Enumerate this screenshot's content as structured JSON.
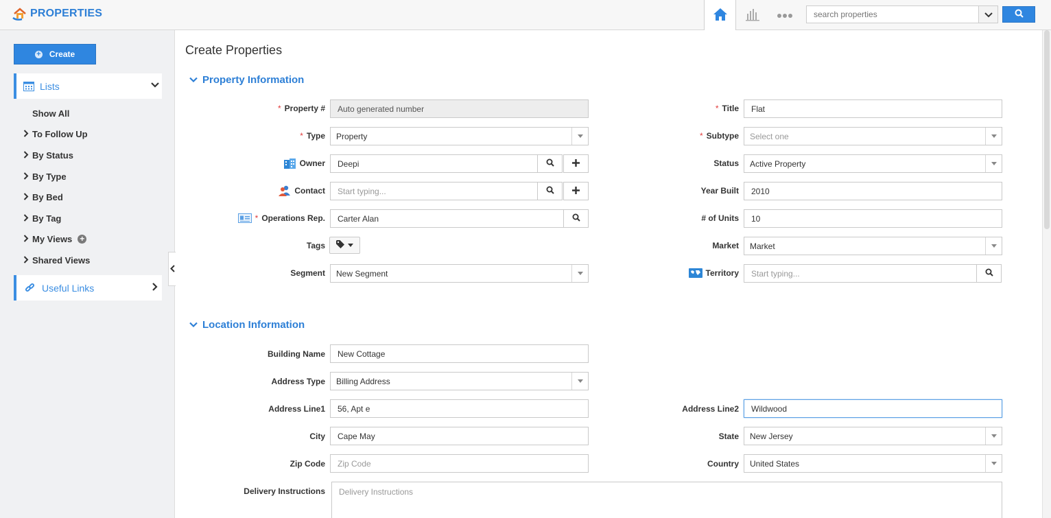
{
  "app": {
    "title": "PROPERTIES"
  },
  "search": {
    "placeholder": "search properties"
  },
  "sidebar": {
    "create_label": "Create",
    "lists_label": "Lists",
    "items": [
      {
        "label": "Show All"
      },
      {
        "label": "To Follow Up"
      },
      {
        "label": "By Status"
      },
      {
        "label": "By Type"
      },
      {
        "label": "By Bed"
      },
      {
        "label": "By Tag"
      },
      {
        "label": "My Views"
      },
      {
        "label": "Shared Views"
      }
    ],
    "useful_links_label": "Useful Links"
  },
  "page": {
    "title": "Create Properties"
  },
  "property_info": {
    "header": "Property Information",
    "property_no": {
      "label": "Property #",
      "value": "Auto generated number"
    },
    "type": {
      "label": "Type",
      "value": "Property"
    },
    "owner": {
      "label": "Owner",
      "value": "Deepi"
    },
    "contact": {
      "label": "Contact",
      "placeholder": "Start typing..."
    },
    "ops_rep": {
      "label": "Operations Rep.",
      "value": "Carter Alan"
    },
    "tags": {
      "label": "Tags"
    },
    "segment": {
      "label": "Segment",
      "value": "New Segment"
    },
    "title": {
      "label": "Title",
      "value": "Flat"
    },
    "subtype": {
      "label": "Subtype",
      "value": "Select one"
    },
    "status": {
      "label": "Status",
      "value": "Active Property"
    },
    "year_built": {
      "label": "Year Built",
      "value": "2010"
    },
    "units": {
      "label": "# of Units",
      "value": "10"
    },
    "market": {
      "label": "Market",
      "value": "Market"
    },
    "territory": {
      "label": "Territory",
      "placeholder": "Start typing..."
    }
  },
  "location_info": {
    "header": "Location Information",
    "building_name": {
      "label": "Building Name",
      "value": "New Cottage"
    },
    "address_type": {
      "label": "Address Type",
      "value": "Billing Address"
    },
    "address_line1": {
      "label": "Address Line1",
      "value": "56, Apt e"
    },
    "address_line2": {
      "label": "Address Line2",
      "value": "Wildwood"
    },
    "city": {
      "label": "City",
      "value": "Cape May"
    },
    "state": {
      "label": "State",
      "value": "New Jersey"
    },
    "zip": {
      "label": "Zip Code",
      "placeholder": "Zip Code"
    },
    "country": {
      "label": "Country",
      "value": "United States"
    },
    "delivery": {
      "label": "Delivery Instructions",
      "placeholder": "Delivery Instructions"
    }
  },
  "colors": {
    "accent": "#2f86e0",
    "required": "#e23b3b"
  }
}
